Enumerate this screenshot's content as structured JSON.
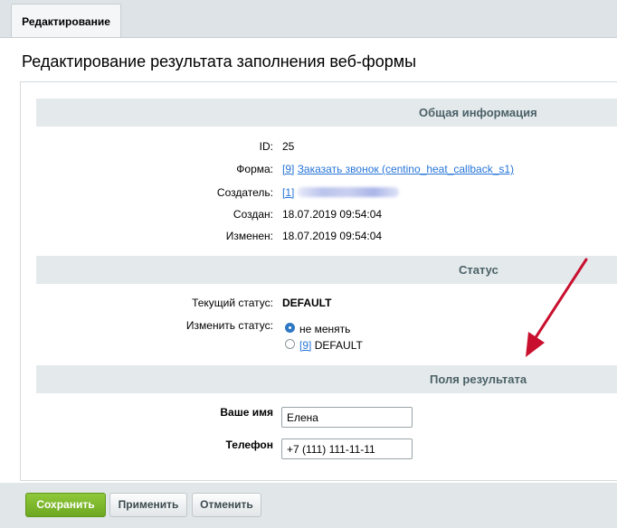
{
  "tab": {
    "label": "Редактирование"
  },
  "page_title": "Редактирование результата заполнения веб-формы",
  "sections": {
    "general": "Общая информация",
    "status": "Статус",
    "result_fields": "Поля результата"
  },
  "general": {
    "id_label": "ID:",
    "id_value": "25",
    "form_label": "Форма:",
    "form_id": "[9]",
    "form_name": "Заказать звонок (centino_heat_callback_s1)",
    "creator_label": "Создатель:",
    "creator_id": "[1]",
    "created_label": "Создан:",
    "created_value": "18.07.2019 09:54:04",
    "modified_label": "Изменен:",
    "modified_value": "18.07.2019 09:54:04"
  },
  "status": {
    "current_label": "Текущий статус:",
    "current_value": "DEFAULT",
    "change_label": "Изменить статус:",
    "option_nochange": "не менять",
    "option_default_id": "[9]",
    "option_default_name": "DEFAULT"
  },
  "fields": {
    "name_label": "Ваше имя",
    "name_value": "Елена",
    "phone_label": "Телефон",
    "phone_value": "+7 (111) 111-11-11"
  },
  "buttons": {
    "save": "Сохранить",
    "apply": "Применить",
    "cancel": "Отменить"
  },
  "colors": {
    "save_button": "#76b02a",
    "link": "#2675d7",
    "annotation_arrow": "#c8102e"
  }
}
